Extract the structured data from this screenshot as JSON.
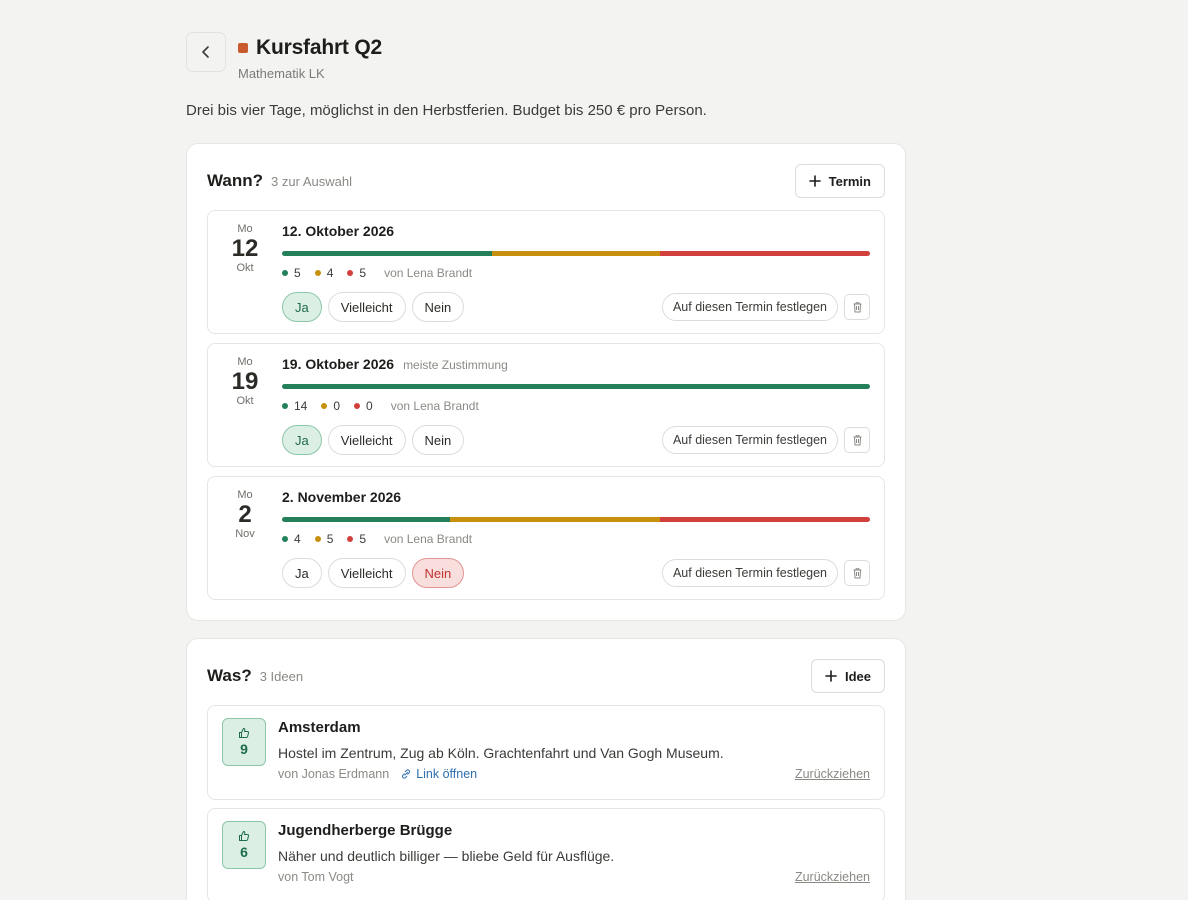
{
  "colors": {
    "accent": "#c95a2e",
    "yes": "#23805a",
    "maybe": "#c8900f",
    "no": "#d2403e"
  },
  "header": {
    "back_icon": "chevron-left-icon",
    "title": "Kursfahrt Q2",
    "subtitle": "Mathematik LK",
    "description": "Drei bis vier Tage, möglichst in den Herbstferien. Budget bis 250 € pro Person."
  },
  "when": {
    "title": "Wann?",
    "count_label": "3 zur Auswahl",
    "add_label": "Termin",
    "vote_labels": {
      "yes": "Ja",
      "maybe": "Vielleicht",
      "no": "Nein"
    },
    "fix_label": "Auf diesen Termin festlegen",
    "dates": [
      {
        "dow": "Mo",
        "day": "12",
        "month": "Okt",
        "title": "12. Oktober 2026",
        "tag": "",
        "yes": 5,
        "maybe": 4,
        "no": 5,
        "yes_s": "5",
        "maybe_s": "4",
        "no_s": "5",
        "by": "von Lena Brandt",
        "my_vote": "yes"
      },
      {
        "dow": "Mo",
        "day": "19",
        "month": "Okt",
        "title": "19. Oktober 2026",
        "tag": "meiste Zustimmung",
        "yes": 14,
        "maybe": 0,
        "no": 0,
        "yes_s": "14",
        "maybe_s": "0",
        "no_s": "0",
        "by": "von Lena Brandt",
        "my_vote": "yes"
      },
      {
        "dow": "Mo",
        "day": "2",
        "month": "Nov",
        "title": "2. November 2026",
        "tag": "",
        "yes": 4,
        "maybe": 5,
        "no": 5,
        "yes_s": "4",
        "maybe_s": "5",
        "no_s": "5",
        "by": "von Lena Brandt",
        "my_vote": "no"
      }
    ]
  },
  "what": {
    "title": "Was?",
    "count_label": "3 Ideen",
    "add_label": "Idee",
    "retract_label": "Zurückziehen",
    "ideas": [
      {
        "votes": "9",
        "title": "Amsterdam",
        "desc": "Hostel im Zentrum, Zug ab Köln. Grachtenfahrt und Van Gogh Museum.",
        "author": "von Jonas Erdmann",
        "link": "Link öffnen"
      },
      {
        "votes": "6",
        "title": "Jugendherberge Brügge",
        "desc": "Näher und deutlich billiger — bliebe Geld für Ausflüge.",
        "author": "von Tom Vogt",
        "link": ""
      }
    ]
  }
}
